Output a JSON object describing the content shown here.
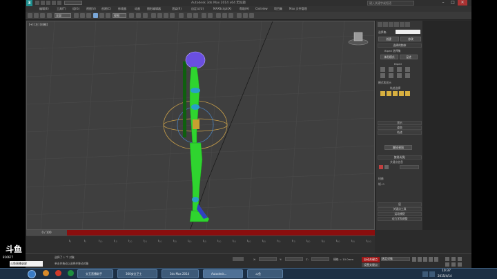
{
  "window": {
    "title": "Autodesk 3ds Max 2014 x64    无标题",
    "search_placeholder": "键入关键字或短语",
    "min": "–",
    "max": "□",
    "close": "✕"
  },
  "menus": [
    "编辑(E)",
    "工具(T)",
    "组(G)",
    "视图(V)",
    "创建(C)",
    "修改器",
    "动画",
    "图形编辑器",
    "渲染(R)",
    "自定义(U)",
    "MAXScript(X)",
    "帮助(H)",
    "Civilview",
    "项目集",
    "Max 文件管理"
  ],
  "toolbar": {
    "selection_filter": "全部",
    "view_ref": "视图"
  },
  "viewport": {
    "label": "[+] [左] [线框]"
  },
  "command_panel": {
    "object_label": "选择集:",
    "tab_a": "创建",
    "tab_b": "修改",
    "rollouts": [
      "选择的物体",
      "Biped 选择集",
      "显示",
      "姿态",
      "轨迹",
      "复制/粘贴",
      "扭曲链接",
      "层",
      "关键点工具",
      "运动捕捉",
      "动力学和调整"
    ],
    "btn_figure": "体形模式",
    "btn_track": "足迹",
    "biped_label": "Biped",
    "mode_label": "模式和显示",
    "track_select_label": "轨迹选择",
    "copy_label": "复制/粘贴",
    "frame_label": "关键点信息",
    "twist_label": "扭曲",
    "num_label": "帧: 0"
  },
  "timeline": {
    "slider": "0 / 100",
    "ticks": [
      "0",
      "5",
      "10",
      "15",
      "20",
      "25",
      "30",
      "35",
      "40",
      "45",
      "50",
      "55",
      "60",
      "65",
      "70",
      "75",
      "80",
      "85",
      "90",
      "95",
      "100"
    ]
  },
  "status": {
    "selected": "选择了 1 个 对象",
    "hint": "单击并拖动以选择并移动对象",
    "x_label": "X:",
    "y_label": "Y:",
    "z_label": "Z:",
    "grid": "栅格 = 10.0mm",
    "autokey": "自动关键点",
    "setkey": "设置关键点",
    "filter": "选定对象"
  },
  "taskbar": {
    "items": [
      "交互直播助手",
      "360安全卫士",
      "3ds Max 2014",
      "Autodesk...",
      "斗鱼"
    ],
    "time": "10:37",
    "date": "2015/4/14"
  },
  "overlay": {
    "logo": "斗鱼",
    "room": "816677",
    "caption": "斗鱼直播录屏"
  },
  "colors": {
    "timeline_red": "#8a0e0e",
    "biped_green": "#2fd42f",
    "biped_purple": "#6a4fe0",
    "panel_blue": "#2d6fb6"
  }
}
